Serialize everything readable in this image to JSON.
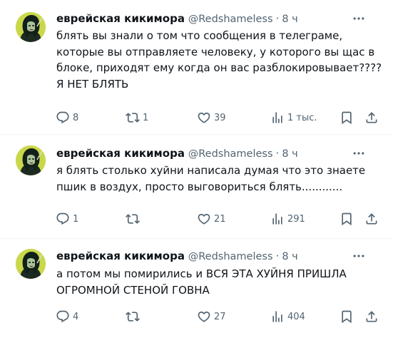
{
  "tweets": [
    {
      "name": "еврейская кикимора",
      "handle": "@Redshameless",
      "dot": "·",
      "time": "8 ч",
      "text": "блять вы знали о том что сообщения в телеграме, которые вы отправляете человеку, у которого вы щас в блоке, приходят ему когда он вас разблокировывает???? Я НЕТ БЛЯТЬ",
      "replies": "8",
      "retweets": "1",
      "likes": "39",
      "views": "1 тыс."
    },
    {
      "name": "еврейская кикимора",
      "handle": "@Redshameless",
      "dot": "·",
      "time": "8 ч",
      "text": "я блять столько хуйни написала думая что это знаете пшик в воздух, просто выговориться блять............",
      "replies": "1",
      "retweets": "",
      "likes": "21",
      "views": "291"
    },
    {
      "name": "еврейская кикимора",
      "handle": "@Redshameless",
      "dot": "·",
      "time": "8 ч",
      "text": "а потом мы помирились и ВСЯ ЭТА ХУЙНЯ ПРИШЛА ОГРОМНОЙ СТЕНОЙ ГОВНА",
      "replies": "4",
      "retweets": "",
      "likes": "27",
      "views": "404"
    }
  ],
  "icons": {
    "reply": "reply-icon",
    "retweet": "retweet-icon",
    "like": "heart-icon",
    "views": "views-icon",
    "bookmark": "bookmark-icon",
    "share": "share-icon",
    "more": "more-icon"
  },
  "colors": {
    "text": "#0f1419",
    "secondary": "#536471",
    "divider": "#eff3f4",
    "avatar_bg": "#c9d84a"
  }
}
